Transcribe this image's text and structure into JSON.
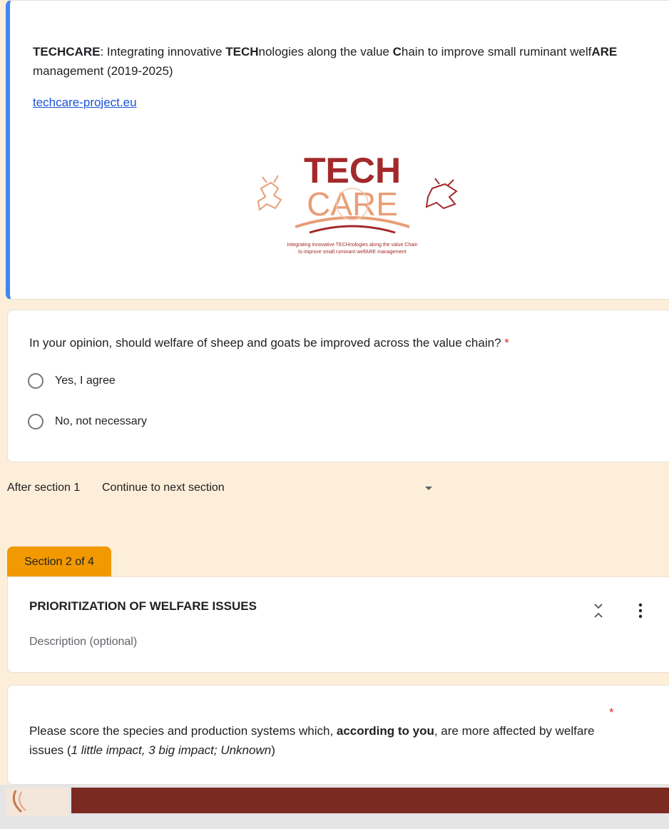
{
  "intro": {
    "title_parts": [
      {
        "text": "TECHCARE",
        "bold": true
      },
      {
        "text": ": Integrating innovative ",
        "bold": false
      },
      {
        "text": "TECH",
        "bold": true
      },
      {
        "text": "nologies along the value ",
        "bold": false
      },
      {
        "text": "C",
        "bold": true
      },
      {
        "text": "hain to improve small ruminant welf",
        "bold": false
      },
      {
        "text": "ARE",
        "bold": true
      },
      {
        "text": " management (2019-2025)",
        "bold": false
      }
    ],
    "link": "techcare-project.eu",
    "logo": {
      "word1": "TECH",
      "word2": "CARE",
      "tagline1": "Integrating innovative TECHnologies along the value Chain",
      "tagline2": "to improve small ruminant welfARE management",
      "colors": {
        "dark": "#a3292a",
        "light": "#e89e76"
      }
    }
  },
  "question1": {
    "text": "In your opinion, should welfare of sheep and goats be improved across the value chain?",
    "required_marker": "*",
    "options": [
      "Yes, I agree",
      "No, not necessary"
    ]
  },
  "after_section": {
    "label": "After section 1",
    "value": "Continue to next section"
  },
  "section2": {
    "tab_label": "Section 2 of 4",
    "title": "PRIORITIZATION OF WELFARE ISSUES",
    "description_placeholder": "Description (optional)",
    "icons": [
      "collapse-icon",
      "more-vert-icon"
    ]
  },
  "question2": {
    "required_marker": "*",
    "parts": [
      {
        "text": "Please score the species and production systems which, ",
        "style": "normal"
      },
      {
        "text": "according to you",
        "style": "bold"
      },
      {
        "text": ", are more affected by welfare issues (",
        "style": "normal"
      },
      {
        "text": "1 little impact, 3 big impact; Unknown",
        "style": "italic"
      },
      {
        "text": ")",
        "style": "normal"
      }
    ]
  },
  "colors": {
    "background": "#fdeed9",
    "accent_blue": "#4285f4",
    "section_tab": "#f29900",
    "required": "#d93025",
    "link": "#1a54d6",
    "brand_dark": "#7a2a21"
  }
}
